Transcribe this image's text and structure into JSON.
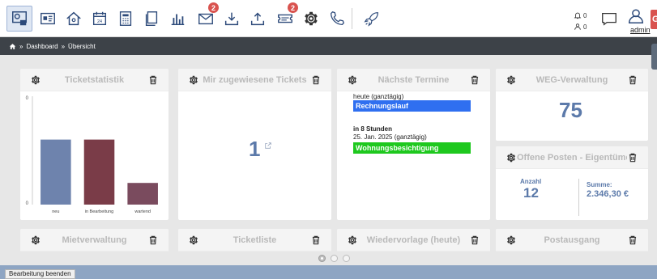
{
  "toolbar": {
    "badges": {
      "mail": "2",
      "tickets": "2"
    },
    "counters": {
      "top": "0",
      "bottom": "0"
    },
    "user": "admin",
    "right_tab_label": "G"
  },
  "breadcrumb": {
    "separator1": "»",
    "dashboard": "Dashboard",
    "separator2": "»",
    "current": "Übersicht"
  },
  "widgets": {
    "ticketstatistik": {
      "title": "Ticketstatistik",
      "chart_data": {
        "type": "bar",
        "categories": [
          "neu",
          "in Bearbeitung",
          "wartend"
        ],
        "values": [
          3,
          3,
          1
        ],
        "y_tick_labels": [
          "0",
          "0"
        ],
        "ylim": [
          0,
          5
        ],
        "colors": [
          "#6e83ad",
          "#7a3c48",
          "#7a4b5e"
        ],
        "grid": false,
        "legend": "none"
      }
    },
    "zugewiesen": {
      "title": "Mir zugewiesene Tickets",
      "count": "1"
    },
    "termine": {
      "title": "Nächste Termine",
      "items": [
        {
          "when": "heute (ganztägig)",
          "when_bold": "",
          "label": "Rechnungslauf",
          "color": "#2f6ff0"
        },
        {
          "when_bold": "in 8 Stunden",
          "when": "25. Jan. 2025 (ganztägig)",
          "label": "Wohnungsbesichtigung",
          "color": "#1ec81e"
        }
      ]
    },
    "weg": {
      "title": "WEG-Verwaltung",
      "count": "75"
    },
    "offene_posten": {
      "title": "Offene Posten - Eigentümer",
      "count_label": "Anzahl",
      "count": "12",
      "sum_label": "Summe:",
      "sum": "2.346,30 €"
    },
    "mietverwaltung": {
      "title": "Mietverwaltung"
    },
    "ticketliste": {
      "title": "Ticketliste"
    },
    "wiedervorlage": {
      "title": "Wiedervorlage (heute)"
    },
    "postausgang": {
      "title": "Postausgang"
    }
  },
  "pager": {
    "active_index": 0,
    "count": 3
  },
  "footer": {
    "end_edit_label": "Bearbeitung beenden"
  },
  "colors": {
    "accent": "#5c7aaa",
    "breadcrumb_bg": "#3d4248",
    "footer_bg": "#8ea5c3",
    "badge": "#d9534f"
  }
}
